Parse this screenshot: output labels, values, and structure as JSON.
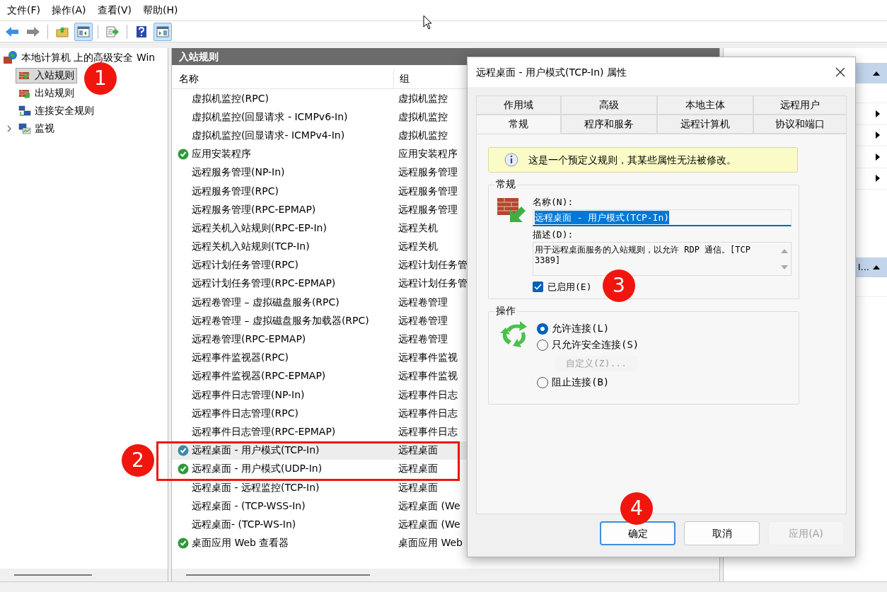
{
  "menu": [
    "文件(F)",
    "操作(A)",
    "查看(V)",
    "帮助(H)"
  ],
  "toolbar": [
    {
      "kind": "back",
      "pressed": false
    },
    {
      "kind": "forward",
      "pressed": false
    },
    {
      "kind": "sep"
    },
    {
      "kind": "folder",
      "pressed": false
    },
    {
      "kind": "pane",
      "pressed": true
    },
    {
      "kind": "sep"
    },
    {
      "kind": "export",
      "pressed": false
    },
    {
      "kind": "sep"
    },
    {
      "kind": "help",
      "pressed": false
    },
    {
      "kind": "pane2",
      "pressed": true
    }
  ],
  "tree": {
    "root": "本地计算机 上的高级安全 Win",
    "items": [
      {
        "label": "入站规则",
        "kind": "inbound",
        "selected": true
      },
      {
        "label": "出站规则",
        "kind": "outbound",
        "selected": false
      },
      {
        "label": "连接安全规则",
        "kind": "connection",
        "selected": false
      },
      {
        "label": "监视",
        "kind": "monitor",
        "selected": false,
        "expanded": false
      }
    ]
  },
  "rules": {
    "title": "入站规则",
    "columns": [
      "名称",
      "组"
    ],
    "rows": [
      {
        "name": "虚拟机监控(RPC)",
        "group": "虚拟机监控",
        "enabled": false,
        "selected": false
      },
      {
        "name": "虚拟机监控(回显请求 - ICMPv6-In)",
        "group": "虚拟机监控",
        "enabled": false,
        "selected": false
      },
      {
        "name": "虚拟机监控(回显请求- ICMPv4-In)",
        "group": "虚拟机监控",
        "enabled": false,
        "selected": false
      },
      {
        "name": "应用安装程序",
        "group": "应用安装程序",
        "enabled": true,
        "selected": false
      },
      {
        "name": "远程服务管理(NP-In)",
        "group": "远程服务管理",
        "enabled": false,
        "selected": false
      },
      {
        "name": "远程服务管理(RPC)",
        "group": "远程服务管理",
        "enabled": false,
        "selected": false
      },
      {
        "name": "远程服务管理(RPC-EPMAP)",
        "group": "远程服务管理",
        "enabled": false,
        "selected": false
      },
      {
        "name": "远程关机入站规则(RPC-EP-In)",
        "group": "远程关机",
        "enabled": false,
        "selected": false
      },
      {
        "name": "远程关机入站规则(TCP-In)",
        "group": "远程关机",
        "enabled": false,
        "selected": false
      },
      {
        "name": "远程计划任务管理(RPC)",
        "group": "远程计划任务管",
        "enabled": false,
        "selected": false
      },
      {
        "name": "远程计划任务管理(RPC-EPMAP)",
        "group": "远程计划任务管",
        "enabled": false,
        "selected": false
      },
      {
        "name": "远程卷管理 – 虚拟磁盘服务(RPC)",
        "group": "远程卷管理",
        "enabled": false,
        "selected": false
      },
      {
        "name": "远程卷管理 – 虚拟磁盘服务加载器(RPC)",
        "group": "远程卷管理",
        "enabled": false,
        "selected": false
      },
      {
        "name": "远程卷管理(RPC-EPMAP)",
        "group": "远程卷管理",
        "enabled": false,
        "selected": false
      },
      {
        "name": "远程事件监视器(RPC)",
        "group": "远程事件监视",
        "enabled": false,
        "selected": false
      },
      {
        "name": "远程事件监视器(RPC-EPMAP)",
        "group": "远程事件监视",
        "enabled": false,
        "selected": false
      },
      {
        "name": "远程事件日志管理(NP-In)",
        "group": "远程事件日志",
        "enabled": false,
        "selected": false
      },
      {
        "name": "远程事件日志管理(RPC)",
        "group": "远程事件日志",
        "enabled": false,
        "selected": false
      },
      {
        "name": "远程事件日志管理(RPC-EPMAP)",
        "group": "远程事件日志",
        "enabled": false,
        "selected": false
      },
      {
        "name": "远程桌面 - 用户模式(TCP-In)",
        "group": "远程桌面",
        "enabled": true,
        "selected": true
      },
      {
        "name": "远程桌面 - 用户模式(UDP-In)",
        "group": "远程桌面",
        "enabled": true,
        "selected": false
      },
      {
        "name": "远程桌面 - 远程监控(TCP-In)",
        "group": "远程桌面",
        "enabled": false,
        "selected": false
      },
      {
        "name": "远程桌面 - (TCP-WSS-In)",
        "group": "远程桌面 (We",
        "enabled": false,
        "selected": false
      },
      {
        "name": "远程桌面- (TCP-WS-In)",
        "group": "远程桌面 (We",
        "enabled": false,
        "selected": false
      },
      {
        "name": "桌面应用 Web 查看器",
        "group": "桌面应用 Web",
        "enabled": true,
        "selected": false
      }
    ]
  },
  "actions": {
    "sections": [
      {
        "kind": "main"
      },
      {
        "kind": "selection",
        "label": "I..."
      }
    ]
  },
  "dialog": {
    "title": "远程桌面 - 用户模式(TCP-In) 属性",
    "tab_rows": [
      [
        {
          "label": "作用域",
          "selected": false
        },
        {
          "label": "高级",
          "selected": false
        },
        {
          "label": "本地主体",
          "selected": false
        },
        {
          "label": "远程用户",
          "selected": false
        }
      ],
      [
        {
          "label": "常规",
          "selected": true
        },
        {
          "label": "程序和服务",
          "selected": false
        },
        {
          "label": "远程计算机",
          "selected": false
        },
        {
          "label": "协议和端口",
          "selected": false
        }
      ]
    ],
    "info": "这是一个预定义规则，其某些属性无法被修改。",
    "general": {
      "title": "常规",
      "name_label": "名称(N):",
      "name_value": "远程桌面 - 用户模式(TCP-In)",
      "desc_label": "描述(D):",
      "description": "用于远程桌面服务的入站规则，以允许 RDP 通信。[TCP 3389]",
      "enabled_label": "已启用(E)",
      "checked": true
    },
    "action": {
      "title": "操作",
      "options": [
        {
          "label": "允许连接(L)",
          "selected": true
        },
        {
          "label": "只允许安全连接(S)",
          "selected": false
        },
        {
          "label": "阻止连接(B)",
          "selected": false
        }
      ],
      "customize": {
        "label": "自定义(Z)...",
        "disabled": true
      }
    },
    "buttons": [
      {
        "label": "确定",
        "default": true,
        "disabled": false
      },
      {
        "label": "取消",
        "default": false,
        "disabled": false
      },
      {
        "label": "应用(A)",
        "default": false,
        "disabled": true
      }
    ]
  },
  "callouts": [
    "1",
    "2",
    "3",
    "4"
  ]
}
